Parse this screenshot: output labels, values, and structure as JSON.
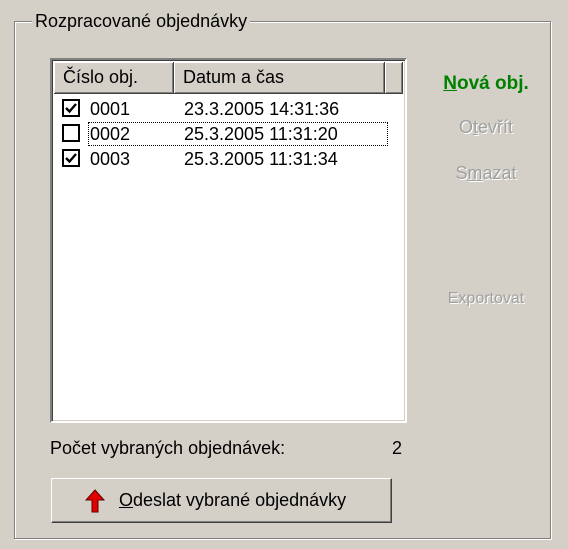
{
  "group": {
    "title": "Rozpracované objednávky"
  },
  "list": {
    "columns": [
      {
        "label": "Číslo obj."
      },
      {
        "label": "Datum a čas"
      }
    ],
    "rows": [
      {
        "number": "0001",
        "datetime": "23.3.2005 14:31:36",
        "checked": true
      },
      {
        "number": "0002",
        "datetime": "25.3.2005 11:31:20",
        "checked": false
      },
      {
        "number": "0003",
        "datetime": "25.3.2005 11:31:34",
        "checked": true
      }
    ]
  },
  "actions": {
    "new_prefix": "N",
    "new_rest": "ová obj.",
    "open_a": "O",
    "open_u": "t",
    "open_b": "evřít",
    "delete_a": "S",
    "delete_u": "m",
    "delete_b": "azat",
    "export": "Exportovat"
  },
  "summary": {
    "label": "Počet vybraných objednávek:",
    "value": "2"
  },
  "send": {
    "underline": "O",
    "rest": "deslat vybrané objednávky"
  },
  "colors": {
    "new_order": "#008000",
    "arrow": "#e00000",
    "disabled": "#a0a0a0"
  },
  "icons": {
    "send": "red-up-arrow-icon",
    "check": "check-icon"
  }
}
